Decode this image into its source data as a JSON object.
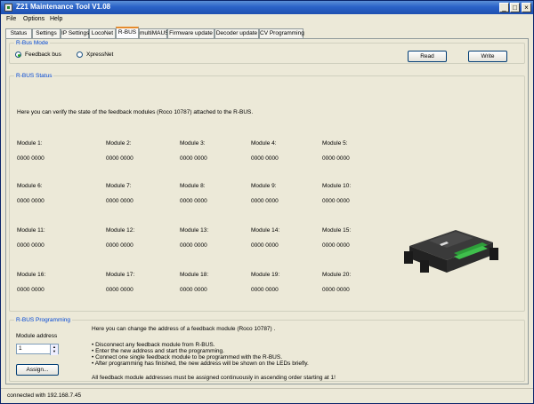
{
  "window": {
    "title": "Z21 Maintenance Tool V1.08",
    "controls": {
      "minimize": "_",
      "maximize": "□",
      "close": "×"
    }
  },
  "menu": [
    "File",
    "Options",
    "Help"
  ],
  "tabs": [
    "Status",
    "Settings",
    "IP Settings",
    "LocoNet",
    "R-BUS",
    "multiMAUS",
    "Firmware update",
    "Decoder update",
    "CV Programming"
  ],
  "active_tab": "R-BUS",
  "rbus_mode": {
    "label": "R-Bus Mode",
    "options": [
      "Feedback bus",
      "XpressNet"
    ],
    "selected": "Feedback bus",
    "read_button": "Read",
    "write_button": "Write"
  },
  "rbus_status": {
    "label": "R-BUS Status",
    "description": "Here you can verify the state of the feedback modules (Roco 10787) attached to the R-BUS.",
    "modules": [
      {
        "name": "Module 1:",
        "value": "0000 0000"
      },
      {
        "name": "Module 2:",
        "value": "0000 0000"
      },
      {
        "name": "Module 3:",
        "value": "0000 0000"
      },
      {
        "name": "Module 4:",
        "value": "0000 0000"
      },
      {
        "name": "Module 5:",
        "value": "0000 0000"
      },
      {
        "name": "Module 6:",
        "value": "0000 0000"
      },
      {
        "name": "Module 7:",
        "value": "0000 0000"
      },
      {
        "name": "Module 8:",
        "value": "0000 0000"
      },
      {
        "name": "Module 9:",
        "value": "0000 0000"
      },
      {
        "name": "Module 10:",
        "value": "0000 0000"
      },
      {
        "name": "Module 11:",
        "value": "0000 0000"
      },
      {
        "name": "Module 12:",
        "value": "0000 0000"
      },
      {
        "name": "Module 13:",
        "value": "0000 0000"
      },
      {
        "name": "Module 14:",
        "value": "0000 0000"
      },
      {
        "name": "Module 15:",
        "value": "0000 0000"
      },
      {
        "name": "Module 16:",
        "value": "0000 0000"
      },
      {
        "name": "Module 17:",
        "value": "0000 0000"
      },
      {
        "name": "Module 18:",
        "value": "0000 0000"
      },
      {
        "name": "Module 19:",
        "value": "0000 0000"
      },
      {
        "name": "Module 20:",
        "value": "0000 0000"
      }
    ]
  },
  "rbus_programming": {
    "label": "R-BUS Programming",
    "address_label": "Module address",
    "address_value": "1",
    "assign_button": "Assign...",
    "intro": "Here you can change the address of a feedback module (Roco 10787) .",
    "steps": [
      "• Disconnect any feedback module from R-BUS.",
      "• Enter the new address and start the programming.",
      "• Connect one single feedback module to be programmed with the R-BUS.",
      "• After programming has finished, the new address will be shown on the LEDs briefly."
    ],
    "note": "All feedback module addresses must be assigned continuously in ascending order starting at 1!"
  },
  "status_bar": "connected with 192.168.7.45"
}
